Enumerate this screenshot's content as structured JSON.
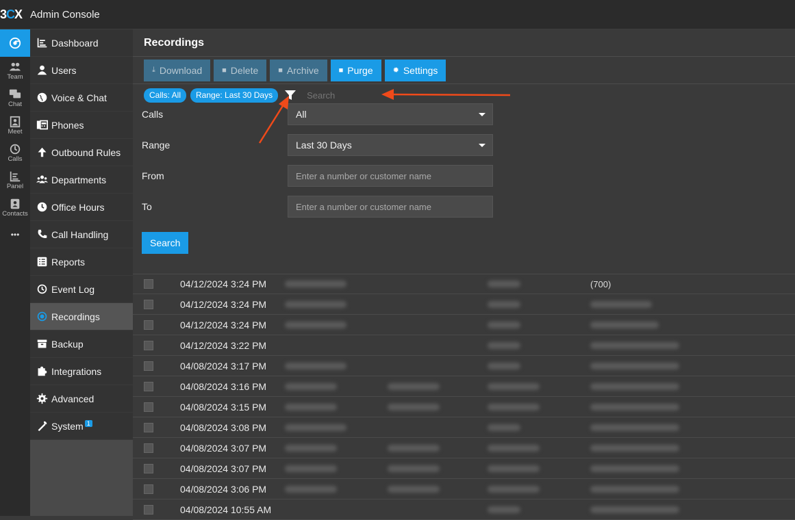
{
  "app": {
    "logo_main": "3",
    "logo_c": "C",
    "logo_x": "X",
    "title": "Admin Console"
  },
  "rail": [
    {
      "label": "",
      "icon": "chrome-icon"
    },
    {
      "label": "Team",
      "icon": "team-icon"
    },
    {
      "label": "Chat",
      "icon": "chat-icon"
    },
    {
      "label": "Meet",
      "icon": "meet-icon"
    },
    {
      "label": "Calls",
      "icon": "history-icon"
    },
    {
      "label": "Panel",
      "icon": "panel-icon"
    },
    {
      "label": "Contacts",
      "icon": "contacts-icon"
    },
    {
      "label": "•••",
      "icon": "more-icon"
    }
  ],
  "sidebar": {
    "items": [
      {
        "label": "Dashboard"
      },
      {
        "label": "Users"
      },
      {
        "label": "Voice & Chat"
      },
      {
        "label": "Phones"
      },
      {
        "label": "Outbound Rules"
      },
      {
        "label": "Departments"
      },
      {
        "label": "Office Hours"
      },
      {
        "label": "Call Handling"
      },
      {
        "label": "Reports"
      },
      {
        "label": "Event Log"
      },
      {
        "label": "Recordings"
      },
      {
        "label": "Backup"
      },
      {
        "label": "Integrations"
      },
      {
        "label": "Advanced"
      },
      {
        "label": "System",
        "badge": "1"
      }
    ]
  },
  "page": {
    "title": "Recordings"
  },
  "toolbar": {
    "download": "Download",
    "delete": "Delete",
    "archive": "Archive",
    "purge": "Purge",
    "settings": "Settings"
  },
  "filters": {
    "chip_calls": "Calls: All",
    "chip_range": "Range: Last 30 Days",
    "search_placeholder": "Search"
  },
  "form": {
    "calls_label": "Calls",
    "calls_value": "All",
    "range_label": "Range",
    "range_value": "Last 30 Days",
    "from_label": "From",
    "from_placeholder": "Enter a number or customer name",
    "to_label": "To",
    "to_placeholder": "Enter a number or customer name",
    "search_button": "Search"
  },
  "rows": [
    {
      "date": "04/12/2024 3:24 PM",
      "ext": "(700)"
    },
    {
      "date": "04/12/2024 3:24 PM",
      "ext": ""
    },
    {
      "date": "04/12/2024 3:24 PM",
      "ext": ""
    },
    {
      "date": "04/12/2024 3:22 PM",
      "ext": ""
    },
    {
      "date": "04/08/2024 3:17 PM",
      "ext": ""
    },
    {
      "date": "04/08/2024 3:16 PM",
      "ext": ""
    },
    {
      "date": "04/08/2024 3:15 PM",
      "ext": ""
    },
    {
      "date": "04/08/2024 3:08 PM",
      "ext": ""
    },
    {
      "date": "04/08/2024 3:07 PM",
      "ext": ""
    },
    {
      "date": "04/08/2024 3:07 PM",
      "ext": ""
    },
    {
      "date": "04/08/2024 3:06 PM",
      "ext": ""
    },
    {
      "date": "04/08/2024 10:55 AM",
      "ext": ""
    }
  ],
  "colors": {
    "accent": "#1a9be6",
    "annotation_arrow": "#f04a1a"
  }
}
